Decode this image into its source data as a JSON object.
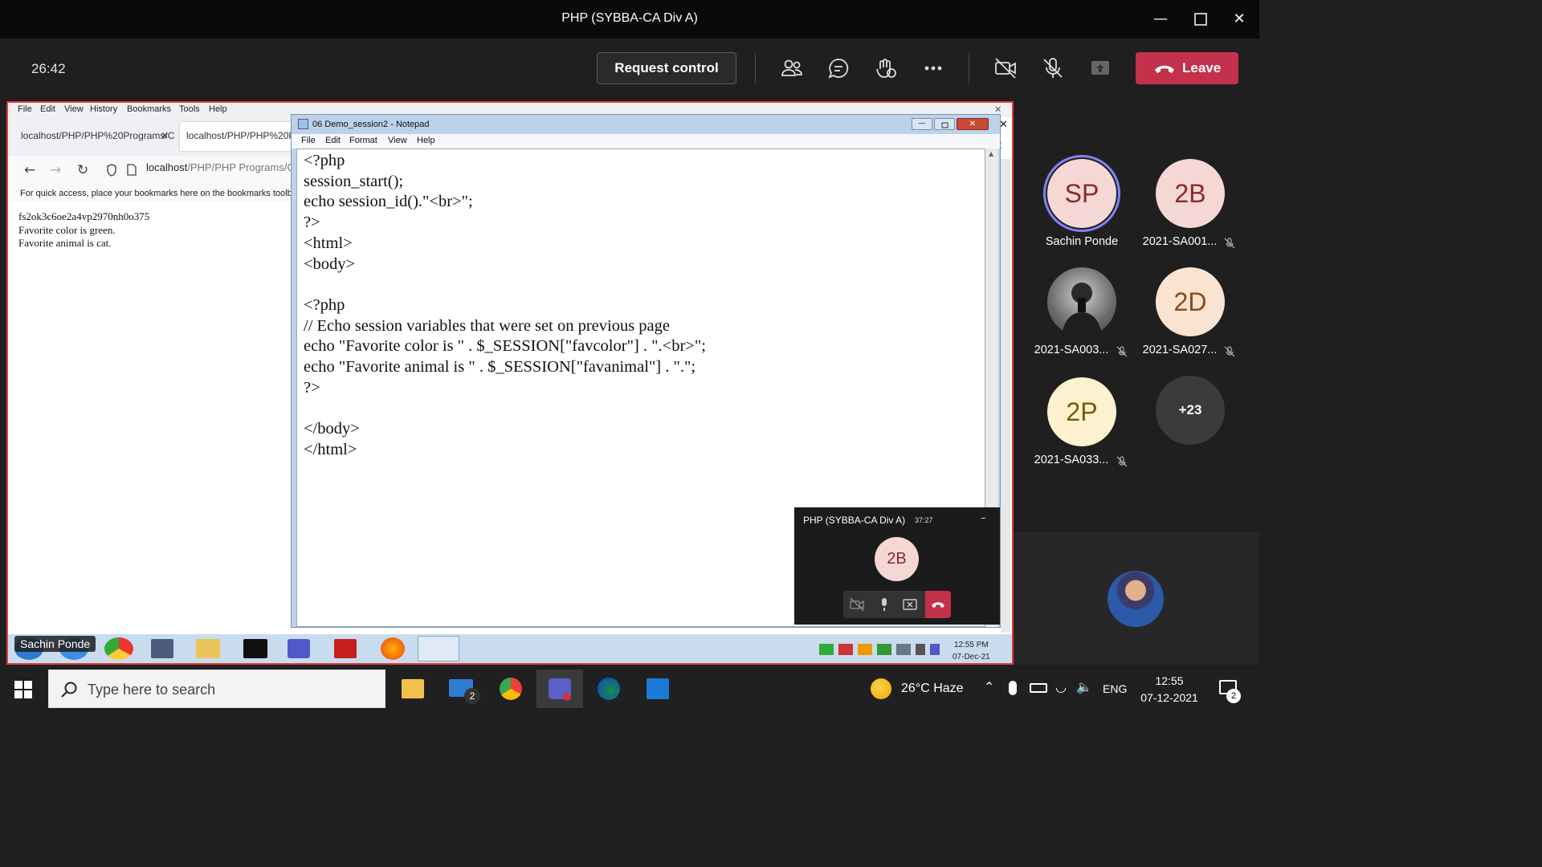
{
  "window": {
    "title": "PHP (SYBBA-CA Div A)"
  },
  "toolbar": {
    "timer": "26:42",
    "request_control_label": "Request control",
    "leave_label": "Leave"
  },
  "firefox": {
    "menu": [
      "File",
      "Edit",
      "View",
      "History",
      "Bookmarks",
      "Tools",
      "Help"
    ],
    "tabs": [
      "localhost/PHP/PHP%20Programs/C",
      "localhost/PHP/PHP%20Pro"
    ],
    "url_host": "localhost",
    "url_path": "/PHP/PHP Programs/C",
    "bookmarks_hint": "For quick access, place your bookmarks here on the bookmarks toolba",
    "content_lines": [
      "fs2ok3c6oe2a4vp2970nh0o375",
      "Favorite color is green.",
      "Favorite animal is cat."
    ]
  },
  "notepad": {
    "title": "06 Demo_session2 - Notepad",
    "menu": [
      "File",
      "Edit",
      "Format",
      "View",
      "Help"
    ],
    "code_lines": [
      "<?php",
      "session_start();",
      "echo session_id().\"<br>\";",
      "?>",
      "<html>",
      "<body>",
      "",
      "<?php",
      "// Echo session variables that were set on previous page",
      "echo \"Favorite color is \" . $_SESSION[\"favcolor\"] . \".<br>\";",
      "echo \"Favorite animal is \" . $_SESSION[\"favanimal\"] . \".\";",
      "?>",
      "",
      "</body>",
      "</html>"
    ]
  },
  "mini_call": {
    "title": "PHP (SYBBA-CA Div A)",
    "time": "37:27",
    "avatar_initials": "2B"
  },
  "remote_taskbar": {
    "presenter": "Sachin Ponde",
    "time": "12:55 PM",
    "date": "07-Dec-21"
  },
  "participants": [
    {
      "initials": "SP",
      "name": "Sachin Ponde",
      "muted": false,
      "bg": "#f5d8d6",
      "fg": "#8b2a2a"
    },
    {
      "initials": "2B",
      "name": "2021-SA001...",
      "muted": true,
      "bg": "#f5d8d6",
      "fg": "#8b2a2a"
    },
    {
      "initials": "",
      "name": "2021-SA003...",
      "muted": true,
      "bg": "#777777",
      "fg": "#ffffff"
    },
    {
      "initials": "2D",
      "name": "2021-SA027...",
      "muted": true,
      "bg": "#fbe3d1",
      "fg": "#8a4a1a"
    },
    {
      "initials": "2P",
      "name": "2021-SA033...",
      "muted": true,
      "bg": "#fdf1cf",
      "fg": "#7a5a00"
    },
    {
      "initials": "+23",
      "name": "",
      "muted": false,
      "bg": "#3b3b3b",
      "fg": "#ffffff"
    }
  ],
  "windows_taskbar": {
    "search_placeholder": "Type here to search",
    "mail_badge": "2",
    "weather": "26°C  Haze",
    "lang": "ENG",
    "time": "12:55",
    "date": "07-12-2021",
    "notif_badge": "2"
  },
  "colors": {
    "leave": "#c4314b",
    "share_border": "#e03b3b",
    "teams_bg": "#1f1f1f"
  }
}
